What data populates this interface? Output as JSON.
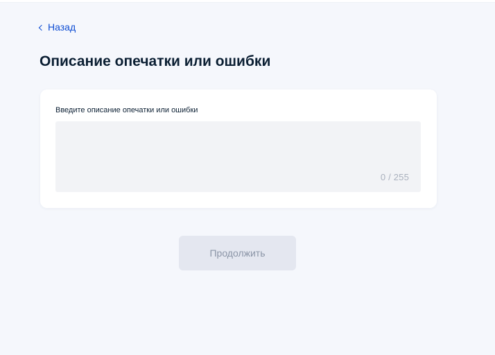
{
  "nav": {
    "back_label": "Назад"
  },
  "page": {
    "title": "Описание опечатки или ошибки"
  },
  "form": {
    "description": {
      "label": "Введите описание опечатки или ошибки",
      "value": "",
      "counter": "0 / 255"
    },
    "continue_label": "Продолжить"
  },
  "colors": {
    "background": "#f5f7fc",
    "card": "#ffffff",
    "link": "#0d4cd3",
    "title": "#0b1f33",
    "input_background": "#f2f3f6",
    "button_disabled_background": "#e4e7f0",
    "button_disabled_text": "#8a94a6"
  },
  "icons": {
    "back": "chevron-left-icon"
  }
}
